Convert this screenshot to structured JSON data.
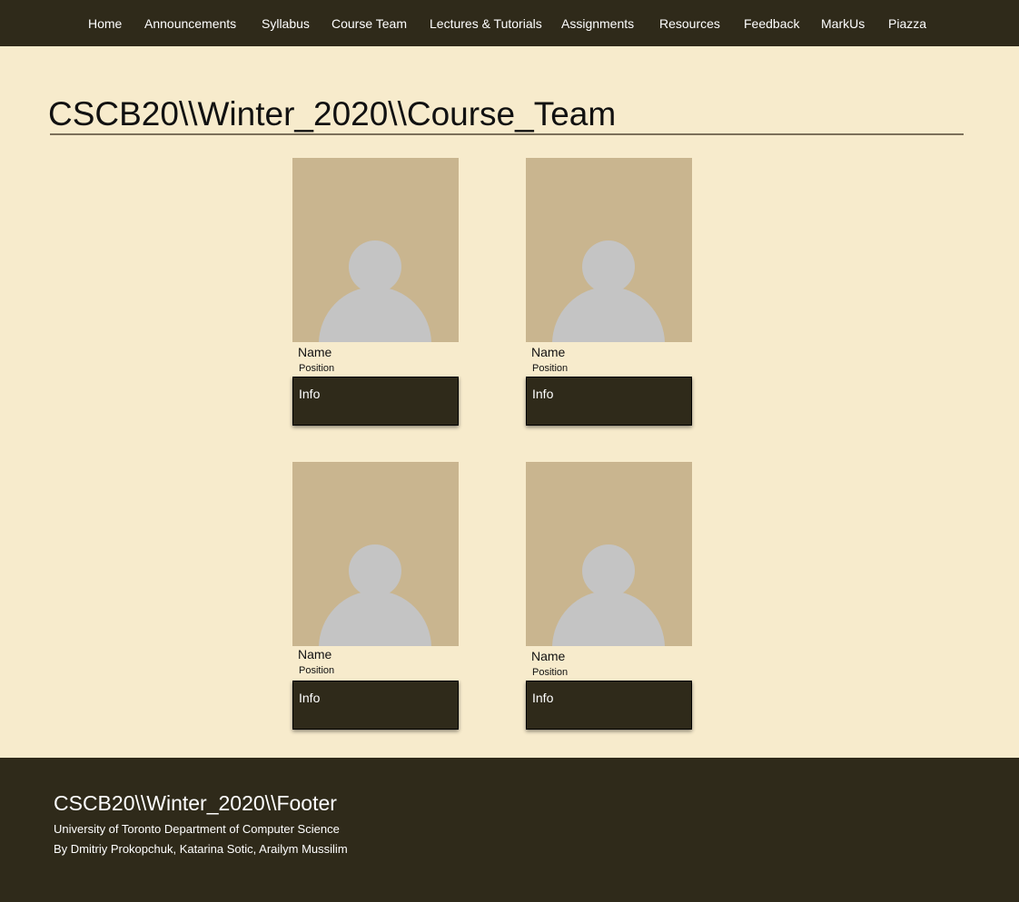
{
  "nav": {
    "items": [
      {
        "label": "Home"
      },
      {
        "label": "Announcements"
      },
      {
        "label": "Syllabus"
      },
      {
        "label": "Course Team"
      },
      {
        "label": "Lectures & Tutorials"
      },
      {
        "label": "Assignments"
      },
      {
        "label": "Resources"
      },
      {
        "label": "Feedback"
      },
      {
        "label": "MarkUs"
      },
      {
        "label": "Piazza"
      }
    ]
  },
  "page": {
    "title": "CSCB20\\\\Winter_2020\\\\Course_Team"
  },
  "team": [
    {
      "name": "Name",
      "position": "Position",
      "info": "Info",
      "photo_icon": "person-silhouette"
    },
    {
      "name": "Name",
      "position": "Position",
      "info": "Info",
      "photo_icon": "person-silhouette"
    },
    {
      "name": "Name",
      "position": "Position",
      "info": "Info",
      "photo_icon": "person-silhouette"
    },
    {
      "name": "Name",
      "position": "Position",
      "info": "Info",
      "photo_icon": "person-silhouette"
    }
  ],
  "footer": {
    "title": "CSCB20\\\\Winter_2020\\\\Footer",
    "line1": "University of Toronto Department of Computer Science",
    "line2": "By Dmitriy Prokopchuk, Katarina Sotic, Arailym Mussilim"
  },
  "colors": {
    "page_background": "#f7ebcc",
    "nav_background": "#2f2a1a",
    "photo_background": "#c9b58f",
    "silhouette": "#c4c4c4"
  }
}
